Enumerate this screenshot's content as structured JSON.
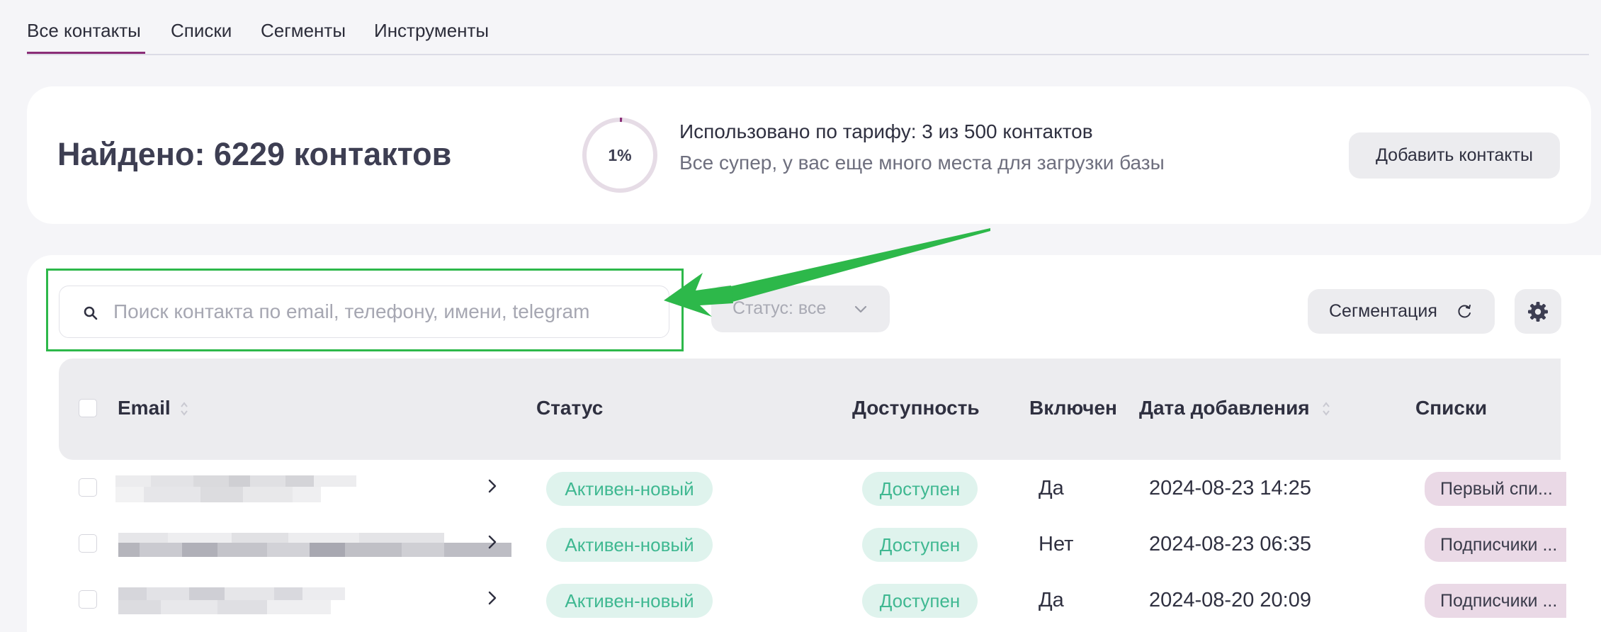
{
  "tabs": [
    {
      "label": "Все контакты",
      "active": true
    },
    {
      "label": "Списки"
    },
    {
      "label": "Сегменты"
    },
    {
      "label": "Инструменты"
    }
  ],
  "summary": {
    "found_text": "Найдено: 6229 контактов",
    "usage_percent_label": "1%",
    "usage_fraction": 0.01,
    "usage_title": "Использовано по тарифу: 3 из 500 контактов",
    "usage_subtitle": "Все супер, у вас еще много места для загрузки базы",
    "add_button": "Добавить контакты"
  },
  "toolbar": {
    "search_placeholder": "Поиск контакта по email, телефону, имени, telegram",
    "status_filter": "Статус: все",
    "segmentation_button": "Сегментация"
  },
  "table": {
    "columns": {
      "email": "Email",
      "status": "Статус",
      "availability": "Доступность",
      "included": "Включен",
      "date_added": "Дата добавления",
      "lists": "Списки"
    },
    "rows": [
      {
        "status": "Активен-новый",
        "availability": "Доступен",
        "included": "Да",
        "date_added": "2024-08-23 14:25",
        "lists": "Первый спи..."
      },
      {
        "status": "Активен-новый",
        "availability": "Доступен",
        "included": "Нет",
        "date_added": "2024-08-23 06:35",
        "lists": "Подписчики ..."
      },
      {
        "status": "Активен-новый",
        "availability": "Доступен",
        "included": "Да",
        "date_added": "2024-08-20 20:09",
        "lists": "Подписчики ..."
      }
    ]
  },
  "colors": {
    "accent": "#8a2d77",
    "status_green": "#3fb891",
    "highlight_green": "#2db84a"
  }
}
